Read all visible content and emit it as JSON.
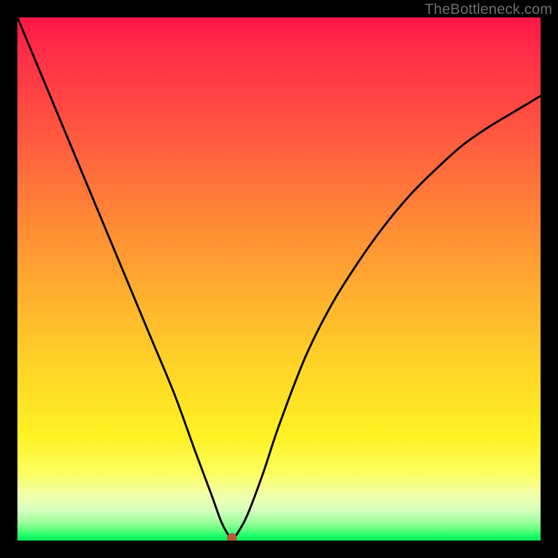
{
  "watermark": "TheBottleneck.com",
  "chart_data": {
    "type": "line",
    "title": "",
    "xlabel": "",
    "ylabel": "",
    "xlim": [
      0,
      100
    ],
    "ylim": [
      0,
      100
    ],
    "grid": false,
    "legend": false,
    "background_gradient": {
      "orientation": "vertical",
      "stops": [
        {
          "pos": 0.0,
          "color": "#ff1649"
        },
        {
          "pos": 0.22,
          "color": "#ff5740"
        },
        {
          "pos": 0.54,
          "color": "#ffb22e"
        },
        {
          "pos": 0.8,
          "color": "#fff123"
        },
        {
          "pos": 0.91,
          "color": "#f3ffa6"
        },
        {
          "pos": 0.97,
          "color": "#7dff8a"
        },
        {
          "pos": 1.0,
          "color": "#08e85e"
        }
      ]
    },
    "series": [
      {
        "name": "bottleneck-curve",
        "color": "#000000",
        "x": [
          0,
          5,
          10,
          15,
          20,
          25,
          30,
          34,
          37,
          39,
          40.5,
          41,
          42,
          44,
          47,
          50,
          55,
          60,
          65,
          70,
          75,
          80,
          85,
          90,
          95,
          100
        ],
        "y": [
          100,
          88,
          76,
          64,
          52,
          40,
          28,
          17,
          9,
          3.5,
          0.8,
          0.5,
          1.3,
          5,
          13,
          22,
          35,
          45,
          53,
          60,
          66,
          71,
          75.5,
          79,
          82,
          85
        ]
      }
    ],
    "marker": {
      "name": "min-point",
      "x": 41,
      "y": 0.5,
      "color": "#c1543f",
      "radius_px": 7
    }
  }
}
